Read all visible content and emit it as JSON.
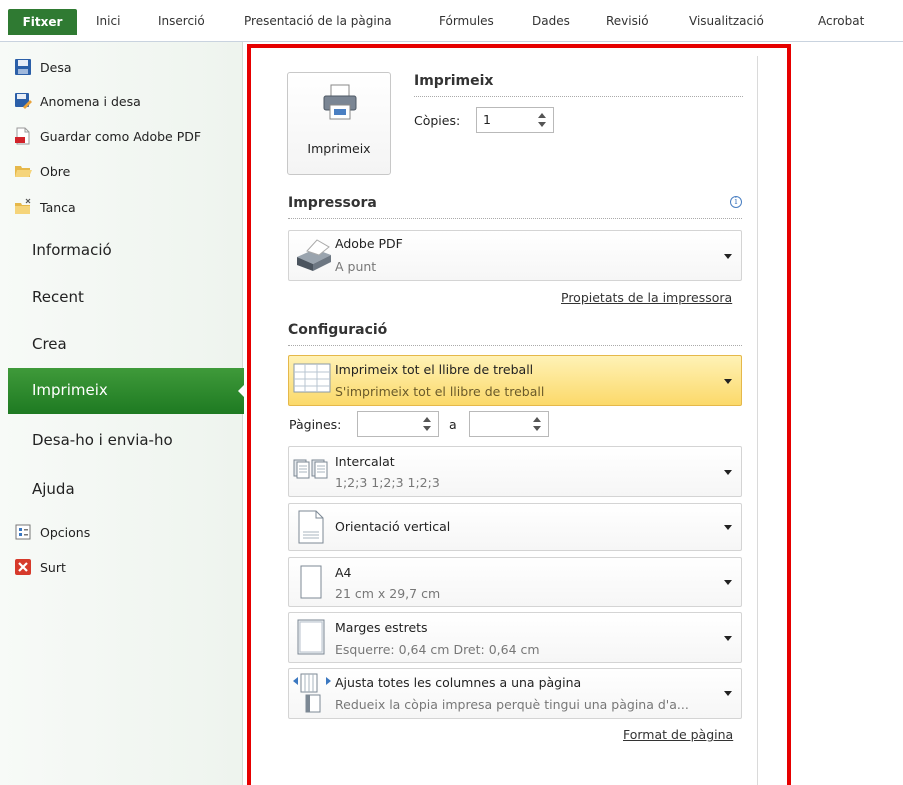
{
  "ribbon": {
    "file_tab": "Fitxer",
    "tabs": [
      "Inici",
      "Inserció",
      "Presentació de la pàgina",
      "Fórmules",
      "Dades",
      "Revisió",
      "Visualització",
      "Acrobat"
    ]
  },
  "nav": {
    "commands": [
      {
        "label": "Desa",
        "icon": "save-icon"
      },
      {
        "label": "Anomena i desa",
        "icon": "save-as-icon"
      },
      {
        "label": "Guardar como Adobe PDF",
        "icon": "pdf-icon"
      },
      {
        "label": "Obre",
        "icon": "open-folder-icon"
      },
      {
        "label": "Tanca",
        "icon": "close-folder-icon"
      }
    ],
    "sections": [
      "Informació",
      "Recent",
      "Crea",
      "Imprimeix",
      "Desa-ho i envia-ho",
      "Ajuda"
    ],
    "selected": "Imprimeix",
    "bottom_commands": [
      {
        "label": "Opcions",
        "icon": "options-icon"
      },
      {
        "label": "Surt",
        "icon": "exit-icon"
      }
    ],
    "accent_color": "#2f8a30"
  },
  "print": {
    "heading": "Imprimeix",
    "button_label": "Imprimeix",
    "copies_label": "Còpies:",
    "copies_value": "1"
  },
  "printer": {
    "heading": "Impressora",
    "name": "Adobe PDF",
    "status": "A punt",
    "properties_link": "Propietats de la impressora"
  },
  "settings": {
    "heading": "Configuració",
    "scope_title": "Imprimeix tot el llibre de treball",
    "scope_sub": "S'imprimeix tot el llibre de treball",
    "pages_label": "Pàgines:",
    "pages_to": "a",
    "pages_from_value": "",
    "pages_to_value": "",
    "collate_title": "Intercalat",
    "collate_sub": "1;2;3   1;2;3   1;2;3",
    "orientation_title": "Orientació vertical",
    "paper_title": "A4",
    "paper_sub": "21 cm x 29,7 cm",
    "margins_title": "Marges estrets",
    "margins_sub": "Esquerre: 0,64 cm    Dret: 0,64 cm",
    "scaling_title": "Ajusta totes les columnes a una pàgina",
    "scaling_sub": "Redueix la còpia impresa perquè tingui una pàgina d'a...",
    "page_setup_link": "Format de pàgina"
  },
  "colors": {
    "highlight_frame": "#e60000",
    "active_dropdown": "#fbd96a"
  }
}
